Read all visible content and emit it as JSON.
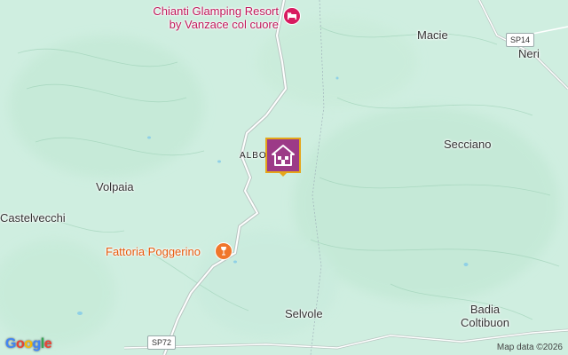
{
  "map": {
    "background": "#cfeee0",
    "labels": [
      {
        "id": "chianti-glamping",
        "text": "Chianti Glamping Resort",
        "line2": "by Vanzace col cuore"
      },
      {
        "id": "macie",
        "text": "Macie"
      },
      {
        "id": "neri",
        "text": "Neri"
      },
      {
        "id": "secciano",
        "text": "Secciano"
      },
      {
        "id": "volpaia",
        "text": "Volpaia"
      },
      {
        "id": "castelvecchi",
        "text": "Castelvecchi"
      },
      {
        "id": "fattoria-poggerino",
        "text": "Fattoria Poggerino"
      },
      {
        "id": "selvole",
        "text": "Selvole"
      },
      {
        "id": "badia",
        "text": "Badia",
        "line2": "Coltibuon"
      },
      {
        "id": "albo",
        "text": "ALBO"
      }
    ],
    "roads": [
      {
        "id": "sp14",
        "text": "SP14"
      },
      {
        "id": "sp72",
        "text": "SP72"
      }
    ],
    "marker": {
      "icon": "house-icon",
      "color": "#9c3a87",
      "border": "#e5a51a"
    },
    "poi_icons": {
      "glamping": "bed-icon",
      "winery": "wine-glass-icon"
    },
    "attribution": "Map data ©2026",
    "logo": "Google"
  }
}
